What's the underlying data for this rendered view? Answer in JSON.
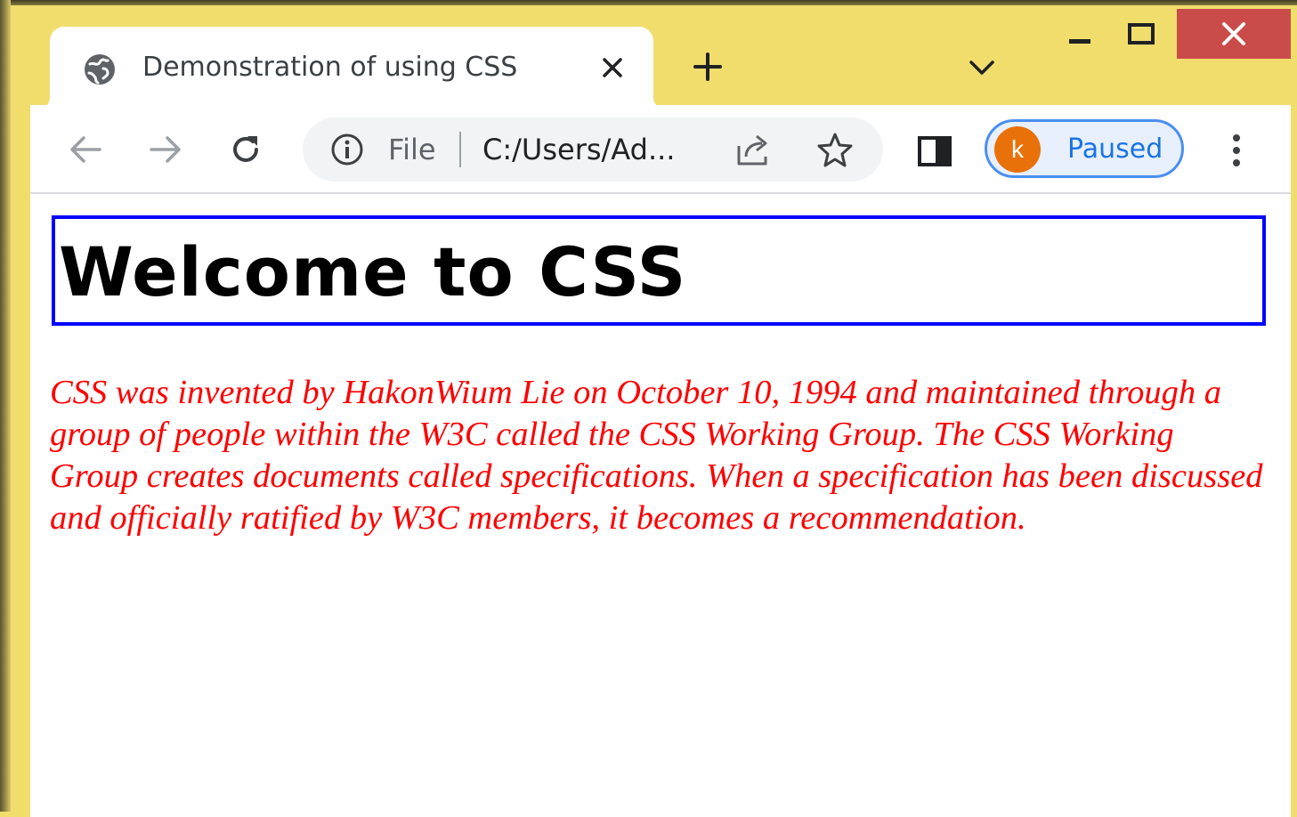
{
  "browser": {
    "tab": {
      "title": "Demonstration of using CSS",
      "favicon": "globe-icon"
    },
    "toolbar": {
      "scheme_label": "File",
      "url": "C:/Users/Ad...",
      "profile_initial": "k",
      "profile_status": "Paused"
    }
  },
  "page": {
    "heading": "Welcome to CSS",
    "paragraph": "CSS was invented by HakonWium Lie on October 10, 1994 and maintained through a group of people within the W3C called the CSS Working Group. The CSS Working Group creates documents called specifications. When a specification has been discussed and officially ratified by W3C members, it becomes a recommendation."
  },
  "colors": {
    "titlebar": "#f1dd6c",
    "close_button": "#c94c4a",
    "heading_border": "#0000ff",
    "paragraph_text": "#ff0000",
    "avatar": "#e8710a",
    "profile_text": "#1a73e8"
  },
  "icons": [
    "globe-icon",
    "close-icon",
    "plus-icon",
    "chevron-down-icon",
    "minimize-icon",
    "maximize-icon",
    "back-arrow-icon",
    "forward-arrow-icon",
    "reload-icon",
    "info-icon",
    "share-icon",
    "star-icon",
    "side-panel-icon",
    "kebab-menu-icon"
  ]
}
